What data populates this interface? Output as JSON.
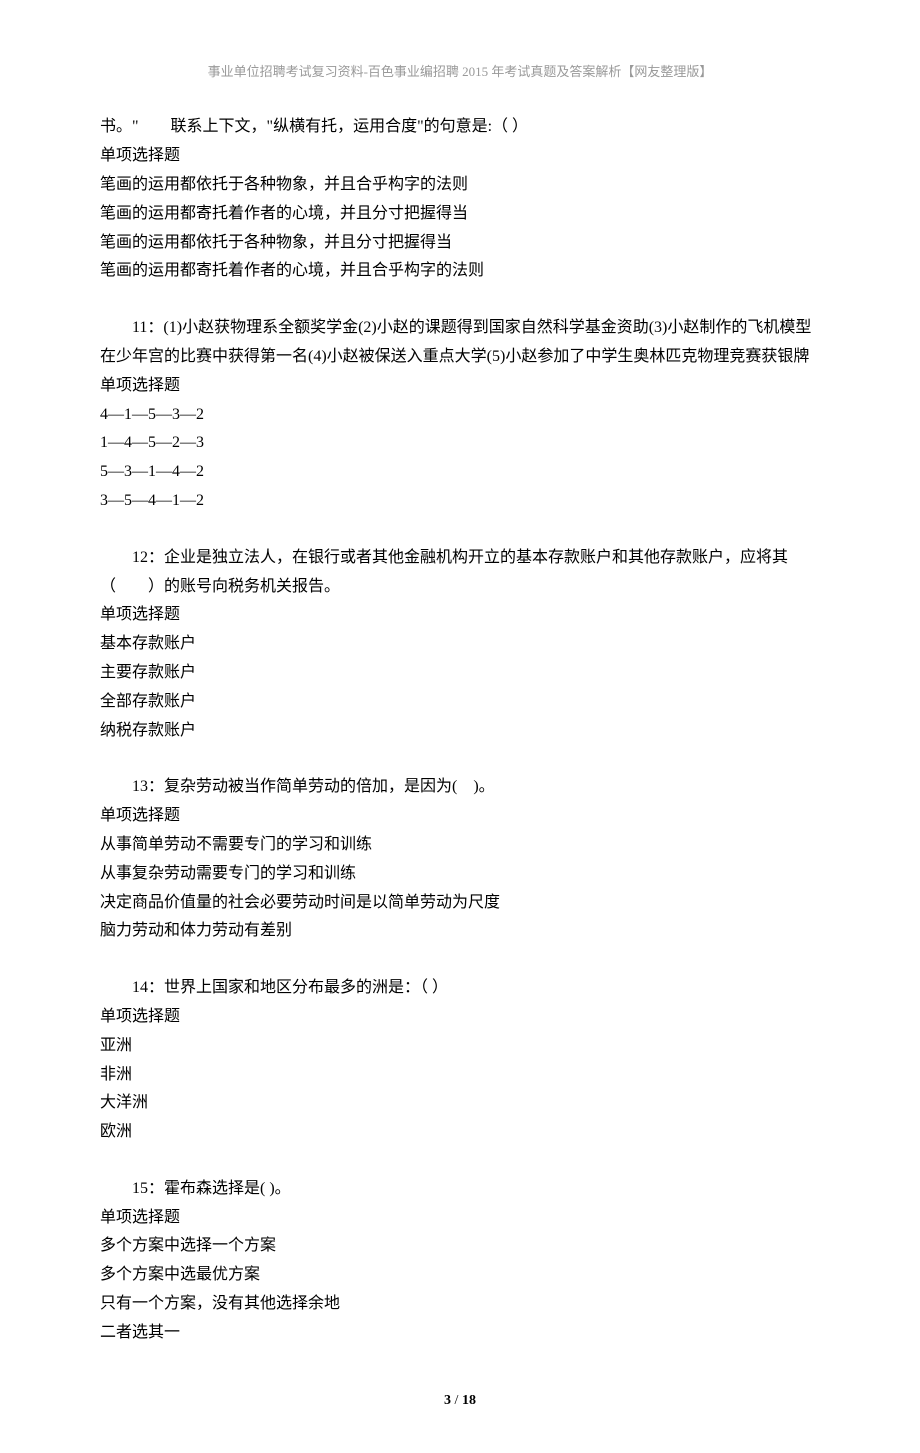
{
  "header": "事业单位招聘考试复习资料-百色事业编招聘 2015 年考试真题及答案解析【网友整理版】",
  "q10_continued": {
    "text": "书。\"　　联系上下文，\"纵横有托，运用合度\"的句意是:（ ）",
    "type": "单项选择题",
    "options": [
      "笔画的运用都依托于各种物象，并且合乎构字的法则",
      "笔画的运用都寄托着作者的心境，并且分寸把握得当",
      "笔画的运用都依托于各种物象，并且分寸把握得当",
      "笔画的运用都寄托着作者的心境，并且合乎构字的法则"
    ]
  },
  "q11": {
    "text": "11：(1)小赵获物理系全额奖学金(2)小赵的课题得到国家自然科学基金资助(3)小赵制作的飞机模型在少年宫的比赛中获得第一名(4)小赵被保送入重点大学(5)小赵参加了中学生奥林匹克物理竞赛获银牌",
    "type": "单项选择题",
    "options": [
      "4—1—5—3—2",
      "1—4—5—2—3",
      "5—3—1—4—2",
      "3—5—4—1—2"
    ]
  },
  "q12": {
    "text": "12：企业是独立法人，在银行或者其他金融机构开立的基本存款账户和其他存款账户，应将其（　　）的账号向税务机关报告。",
    "type": "单项选择题",
    "options": [
      "基本存款账户",
      "主要存款账户",
      "全部存款账户",
      "纳税存款账户"
    ]
  },
  "q13": {
    "text": "13：复杂劳动被当作简单劳动的倍加，是因为(　)。",
    "type": "单项选择题",
    "options": [
      "从事简单劳动不需要专门的学习和训练",
      "从事复杂劳动需要专门的学习和训练",
      "决定商品价值量的社会必要劳动时间是以简单劳动为尺度",
      "脑力劳动和体力劳动有差别"
    ]
  },
  "q14": {
    "text": "14：世界上国家和地区分布最多的洲是：（ ）",
    "type": "单项选择题",
    "options": [
      "亚洲",
      "非洲",
      "大洋洲",
      "欧洲"
    ]
  },
  "q15": {
    "text": "15：霍布森选择是( )。",
    "type": "单项选择题",
    "options": [
      "多个方案中选择一个方案",
      "多个方案中选最优方案",
      "只有一个方案，没有其他选择余地",
      "二者选其一"
    ]
  },
  "footer": {
    "page_current": "3",
    "page_separator": " / ",
    "page_total": "18"
  }
}
